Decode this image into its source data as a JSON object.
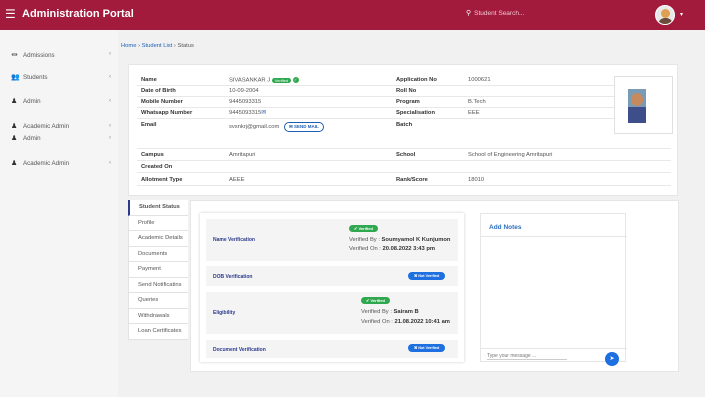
{
  "header": {
    "title": "Administration Portal",
    "search_placeholder": "Student Search..."
  },
  "sidebar": {
    "items": [
      {
        "label": "Admissions",
        "icon": "bank-icon"
      },
      {
        "label": "Students",
        "icon": "users-icon"
      },
      {
        "label": "Admin",
        "icon": "user-icon"
      },
      {
        "label": "Academic Admin",
        "icon": "user-icon"
      },
      {
        "label": "Admin",
        "icon": "user-icon"
      },
      {
        "label": "Academic Admin",
        "icon": "user-icon"
      }
    ]
  },
  "breadcrumb": {
    "home": "Home",
    "list": "Student List",
    "current": "Status",
    "sep": "›"
  },
  "student": {
    "name_label": "Name",
    "name": "SIVASANKAR J",
    "verified_badge": "Verified",
    "dob_label": "Date of Birth",
    "dob": "10-09-2004",
    "mobile_label": "Mobile Number",
    "mobile": "9445093315",
    "whatsapp_label": "Whatsapp Number",
    "whatsapp": "9445093315",
    "email_label": "Email",
    "email": "svsnkrj@gmail.com",
    "send_mail": "SEND MAIL",
    "campus_label": "Campus",
    "campus": "Amritapuri",
    "created_label": "Created On",
    "created": "",
    "allotment_label": "Allotment Type",
    "allotment": "AEEE",
    "appno_label": "Application No",
    "appno": "1000621",
    "rollno_label": "Roll No",
    "rollno": "",
    "program_label": "Program",
    "program": "B.Tech",
    "spec_label": "Specialisation",
    "spec": "EEE",
    "batch_label": "Batch",
    "batch": "",
    "school_label": "School",
    "school": "School of Engineering  Amritapuri",
    "rank_label": "Rank/Score",
    "rank": "18010"
  },
  "tabs": [
    "Student Status",
    "Profile",
    "Academic Details",
    "Documents",
    "Payment",
    "Send Notificatins",
    "Queries",
    "Withdrawals",
    "Loan Certificates"
  ],
  "verification": {
    "name_ver": {
      "label": "Name Verification",
      "badge": "✔ Verified",
      "by_label": "Verified By : ",
      "by": "Soumyamol K Kunjumon",
      "on_label": "Verified On : ",
      "on": "20.08.2022 3:43 pm"
    },
    "dob_ver": {
      "label": "DOB Verification",
      "badge": "✖ Not Verified"
    },
    "eligibility": {
      "label": "Eligibility",
      "badge": "✔ Verified",
      "by_label": "Verified By : ",
      "by": "Sairam B",
      "on_label": "Verified On : ",
      "on": "21.08.2022 10:41 am"
    },
    "doc_ver": {
      "label": "Document Verification",
      "badge": "✖ Not Verified"
    }
  },
  "notes": {
    "title": "Add Notes",
    "placeholder": "Type your message ..."
  },
  "colors": {
    "brand": "#a21a3c",
    "verified": "#2fa84f",
    "not_verified": "#1e6fe0",
    "accent": "#2b3a8c"
  }
}
